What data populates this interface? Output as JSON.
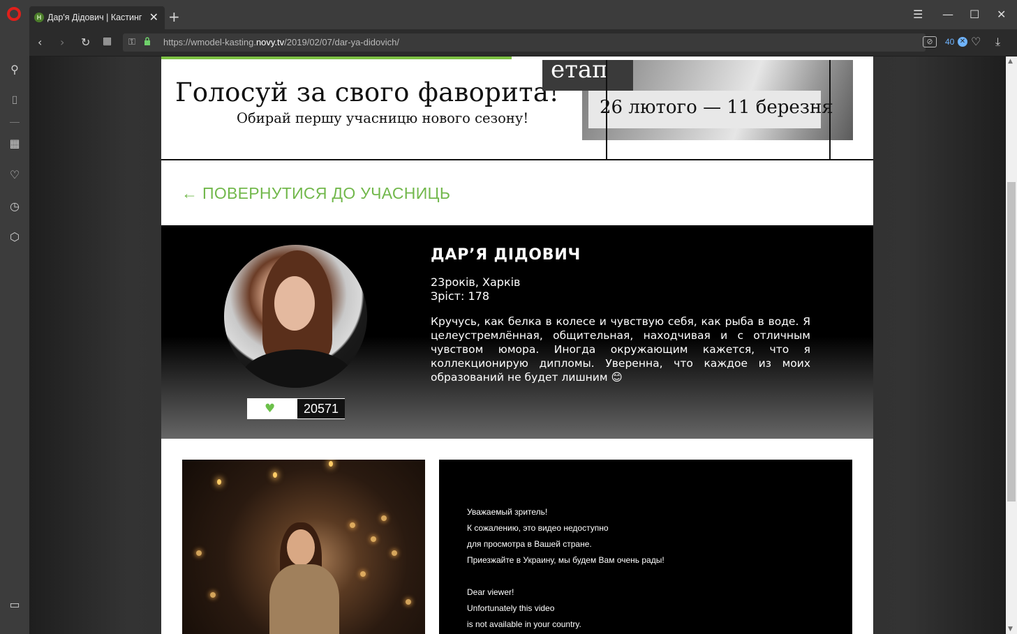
{
  "browser": {
    "tab_title": "Дар'я Дідович | Кастинг",
    "favicon_letter": "Н",
    "url_prefix": "https://wmodel-kasting.",
    "url_domain": "novy.tv",
    "url_path": "/2019/02/07/dar-ya-didovich/",
    "blocked_count": "40"
  },
  "banner": {
    "title": "Голосуй за свого фаворита!",
    "subtitle": "Обирай першу учасницю нового сезону!",
    "stage_label": "етап",
    "dates": "26 лютого — 11 березня"
  },
  "back_link": "← ПОВЕРНУТИСЯ ДО УЧАСНИЦЬ",
  "profile": {
    "name": "ДАР’Я ДІДОВИЧ",
    "age_city": "23років, Харків",
    "height": "Зріст: 178",
    "bio": "Кручусь, как белка в колесе и чувствую себя, как рыба в воде. Я целеустремлённая, общительная, находчивая и с отличным чувством юмора. Иногда окружающим кажется, что я коллекционирую дипломы. Уверенна, что каждое из моих образований не будет лишним 😊",
    "likes": "20571"
  },
  "video_notice": {
    "lines": [
      "Уважаемый зритель!",
      "К сожалению, это видео недоступно",
      "для просмотра в Вашей стране.",
      "Приезжайте в Украину, мы будем Вам очень рады!",
      "",
      "Dear viewer!",
      "Unfortunately this video",
      "is not available in your country."
    ]
  },
  "colors": {
    "accent_green": "#72b84c",
    "heart_green": "#6cc04a",
    "opera_red": "#e0201b"
  }
}
